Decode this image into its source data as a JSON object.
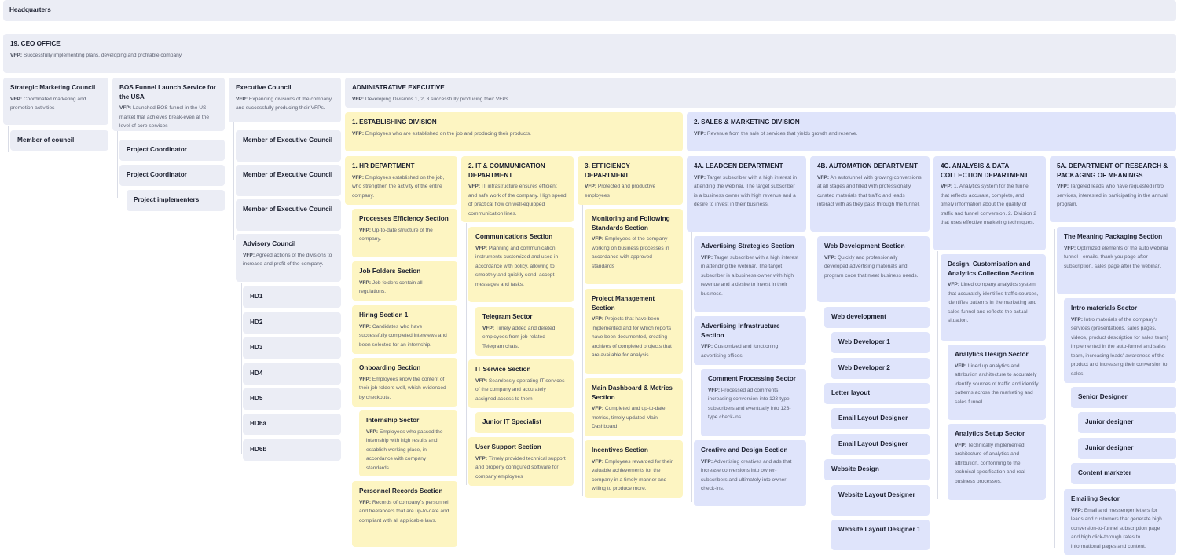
{
  "vfp_label": "VFP:",
  "colors": {
    "grey": "#ebedf5",
    "yellow": "#fdf5c2",
    "blue": "#dfe4fb"
  },
  "headquarters": {
    "title": "Headquarters"
  },
  "ceo": {
    "title": "19. CEO OFFICE",
    "vfp": "Successfully implementing plans, developing and profitable company"
  },
  "strategic": {
    "title": "Strategic Marketing Council",
    "vfp": "Coordinated marketing and promotion activities",
    "member": "Member of council"
  },
  "bos": {
    "title": "BOS Funnel Launch Service for the USA",
    "vfp": "Launched BOS funnel in the US market that achieves break-even at the level of core services",
    "coord1": "Project Coordinator",
    "coord2": "Project Coordinator",
    "implementers": "Project implementers"
  },
  "exec": {
    "title": "Executive Council",
    "vfp": "Expanding divisions of the company and successfully producing their VFPs.",
    "members": [
      "Member of Executive Council",
      "Member of Executive Council",
      "Member of Executive Council"
    ],
    "advisory_title": "Advisory Council",
    "advisory_vfp": "Agreed actions of the divisions to increase and profit of the company.",
    "hd": [
      "HD1",
      "HD2",
      "HD3",
      "HD4",
      "HD5",
      "HD6a",
      "HD6b"
    ]
  },
  "admin": {
    "title": "ADMINISTRATIVE EXECUTIVE",
    "vfp": "Developing Divisions 1, 2, 3 successfully producing their VFPs"
  },
  "div1": {
    "title": "1. ESTABLISHING DIVISION",
    "vfp": "Employees who are established on the job and producing their products."
  },
  "div2": {
    "title": "2. SALES & MARKETING DIVISION",
    "vfp": "Revenue from the sale of services that yields growth and reserve."
  },
  "hr": {
    "title": "1. HR DEPARTMENT",
    "vfp": "Employees established on the job, who strengthen the activity of the entire company.",
    "s1_title": "Processes Efficiency Section",
    "s1_vfp": "Up-to-date structure of the company.",
    "s2_title": "Job Folders Section",
    "s2_vfp": "Job folders contain all regulations.",
    "s3_title": "Hiring Section 1",
    "s3_vfp": "Candidates who have successfully completed interviews and been selected for an internship.",
    "s4_title": "Onboarding Section",
    "s4_vfp": "Employees know the content of their job folders well, which evidenced by checkouts.",
    "s5_title": "Internship Sector",
    "s5_vfp": "Employees who passed the internship with high results and establish working place, in accordance with company standards.",
    "s6_title": "Personnel Records Section",
    "s6_vfp": "Records of company`s personnel and freelancers that are up-to-date and compliant with all applicable laws."
  },
  "it": {
    "title": "2. IT & COMMUNICATION DEPARTMENT",
    "vfp": "IT infrastructure ensures efficient and safe work of the company. High speed of practical flow on well-equipped communication lines.",
    "s1_title": "Communications Section",
    "s1_vfp": "Planning and communication instruments customized and used in accordance with policy, allowing to smoothly and quickly send, accept messages and tasks.",
    "s2_title": "Telegram Sector",
    "s2_vfp": "Timely added and deleted employees from job-related Telegram chats.",
    "s3_title": "IT Service Section",
    "s3_vfp": "Seamlessly operating IT services of the company and accurately assigned access to them",
    "s4_title": "Junior IT Specialist",
    "s5_title": "User Support Section",
    "s5_vfp": "Timely provided technical support and properly configured software for company employees"
  },
  "eff": {
    "title": "3. EFFICIENCY DEPARTMENT",
    "vfp": "Protected and productive employees",
    "s1_title": "Monitoring and Following Standards Section",
    "s1_vfp": "Employees of the company working on business processes in accordance with approved standards",
    "s2_title": "Project Management Section",
    "s2_vfp": "Projects that have been implemented and for which reports have been documented, creating archives of completed projects that are available for analysis.",
    "s3_title": "Main Dashboard & Metrics Section",
    "s3_vfp": "Completed and up-to-date metrics, timely updated Main Dashboard",
    "s4_title": "Incentives Section",
    "s4_vfp": "Employees rewarded for their valuable achievements for the company in a timely manner and willing to produce more."
  },
  "leadgen": {
    "title": "4A. LEADGEN DEPARTMENT",
    "vfp": "Target subscriber with a high interest in attending the webinar. The target subscriber is a business owner with high revenue and a desire to invest in their business.",
    "s1_title": "Advertising Strategies Section",
    "s1_vfp": "Target subscriber with a high interest in attending the webinar. The target subscriber is a business owner with high revenue and a desire to invest in their business.",
    "s2_title": "Advertising Infrastructure Section",
    "s2_vfp": "Customized and functioning advertising offices",
    "s3_title": "Comment Processing Sector",
    "s3_vfp": "Processed ad comments, increasing conversion into 123-type subscribers and eventually into 123-type check-ins.",
    "s4_title": "Creative and Design Section",
    "s4_vfp": "Advertising creatives and ads that increase conversions into owner-subscribers and ultimately into owner-check-ins."
  },
  "auto": {
    "title": "4B. AUTOMATION DEPARTMENT",
    "vfp": "An autofunnel with growing conversions at all stages and filled with professionally curated materials that traffic and leads interact with as they pass through the funnel.",
    "s1_title": "Web Development Section",
    "s1_vfp": "Quickly and professionally developed advertising materials and program code that meet business needs.",
    "webdev": "Web development",
    "wd1": "Web Developer 1",
    "wd2": "Web Developer 2",
    "letter": "Letter layout",
    "eld1": "Email Layout Designer",
    "eld2": "Email Layout Designer",
    "website": "Website Design",
    "wld": "Website Layout Designer",
    "wld1": "Website Layout Designer 1"
  },
  "analysis": {
    "title": "4C. ANALYSIS & DATA COLLECTION DEPARTMENT",
    "vfp": "1. Analytics system for the funnel that reflects accurate, complete, and timely information about the quality of traffic and funnel conversion. 2. Division 2 that uses effective marketing techniques.",
    "s1_title": "Design, Customisation and Analytics Collection Section",
    "s1_vfp": "Lined company analytics system that accurately identifies traffic sources, identifies patterns in the marketing and sales funnel and reflects the actual situation.",
    "s2_title": "Analytics Design Sector",
    "s2_vfp": "Lined up analytics and attribution architecture to accurately identify sources of traffic and identify patterns across the marketing and sales funnel.",
    "s3_title": "Analytics Setup Sector",
    "s3_vfp": "Technically implemented architecture of analytics and attribution, conforming to the technical specification and real business processes."
  },
  "research": {
    "title": "5A. DEPARTMENT OF RESEARCH & PACKAGING OF MEANINGS",
    "vfp": "Targeted leads who have requested intro services, interested in participating in the annual program.",
    "s1_title": "The Meaning Packaging Section",
    "s1_vfp": "Optimized elements of the auto webinar funnel - emails, thank you page after subscription, sales page after the webinar.",
    "s2_title": "Intro materials Sector",
    "s2_vfp": "Intro materials of the company's services (presentations, sales pages, videos, product description for sales team) implemented in the auto-funnel and sales team, increasing leads' awareness of the product and increasing their conversion to sales.",
    "senior": "Senior Designer",
    "jd1": "Junior designer",
    "jd2": "Junior designer",
    "content": "Content marketer",
    "s3_title": "Emailing Sector",
    "s3_vfp": "Email and messenger letters for leads and customers that generate high conversion-to-funnel subscription page and high click-through rates to informational pages and content."
  }
}
